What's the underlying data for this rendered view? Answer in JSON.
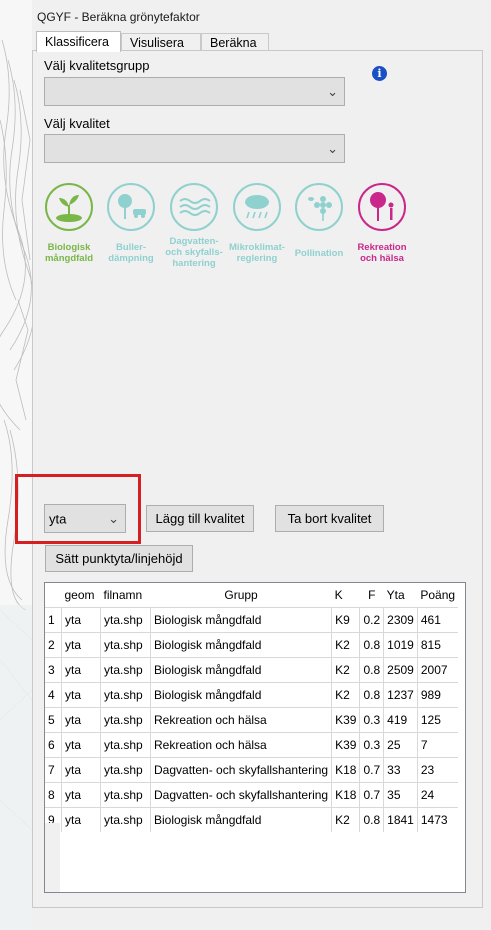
{
  "window": {
    "title": "QGYF - Beräkna grönytefaktor"
  },
  "tabs": [
    {
      "label": "Klassificera",
      "active": true
    },
    {
      "label": "Visulisera",
      "active": false
    },
    {
      "label": "Beräkna",
      "active": false
    }
  ],
  "form": {
    "quality_group_label": "Välj kvalitetsgrupp",
    "quality_group_value": "",
    "quality_label": "Välj kvalitet",
    "quality_value": ""
  },
  "categories": [
    {
      "label": "Biologisk mångdfald",
      "color": "#7ab648",
      "icon": "sprout-icon"
    },
    {
      "label": "Buller-dämpning",
      "color": "#8fd1ce",
      "icon": "tree-car-icon"
    },
    {
      "label": "Dagvatten- och skyfalls-hantering",
      "color": "#8fd1ce",
      "icon": "water-waves-icon"
    },
    {
      "label": "Mikroklimat-reglering",
      "color": "#8fd1ce",
      "icon": "cloud-rain-icon"
    },
    {
      "label": "Pollination",
      "color": "#8fd1ce",
      "icon": "flower-bee-icon"
    },
    {
      "label": "Rekreation och hälsa",
      "color": "#c9288a",
      "icon": "tree-person-icon"
    }
  ],
  "controls": {
    "geom_select_value": "yta",
    "add_button": "Lägg till kvalitet",
    "remove_button": "Ta bort kvalitet",
    "set_point_button": "Sätt punktyta/linjehöjd"
  },
  "table": {
    "columns": [
      "geom",
      "filnamn",
      "Grupp",
      "K",
      "F",
      "Yta",
      "Poäng"
    ],
    "rows": [
      [
        "1",
        "yta",
        "yta.shp",
        "Biologisk mångdfald",
        "K9",
        "0.2",
        "2309",
        "461"
      ],
      [
        "2",
        "yta",
        "yta.shp",
        "Biologisk mångdfald",
        "K2",
        "0.8",
        "1019",
        "815"
      ],
      [
        "3",
        "yta",
        "yta.shp",
        "Biologisk mångdfald",
        "K2",
        "0.8",
        "2509",
        "2007"
      ],
      [
        "4",
        "yta",
        "yta.shp",
        "Biologisk mångdfald",
        "K2",
        "0.8",
        "1237",
        "989"
      ],
      [
        "5",
        "yta",
        "yta.shp",
        "Rekreation och hälsa",
        "K39",
        "0.3",
        "419",
        "125"
      ],
      [
        "6",
        "yta",
        "yta.shp",
        "Rekreation och hälsa",
        "K39",
        "0.3",
        "25",
        "7"
      ],
      [
        "7",
        "yta",
        "yta.shp",
        "Dagvatten- och skyfallshantering",
        "K18",
        "0.7",
        "33",
        "23"
      ],
      [
        "8",
        "yta",
        "yta.shp",
        "Dagvatten- och skyfallshantering",
        "K18",
        "0.7",
        "35",
        "24"
      ],
      [
        "9",
        "yta",
        "yta.shp",
        "Biologisk mångdfald",
        "K2",
        "0.8",
        "1841",
        "1473"
      ]
    ]
  },
  "colors": {
    "highlight": "#d42020",
    "info": "#1b4fc4"
  }
}
